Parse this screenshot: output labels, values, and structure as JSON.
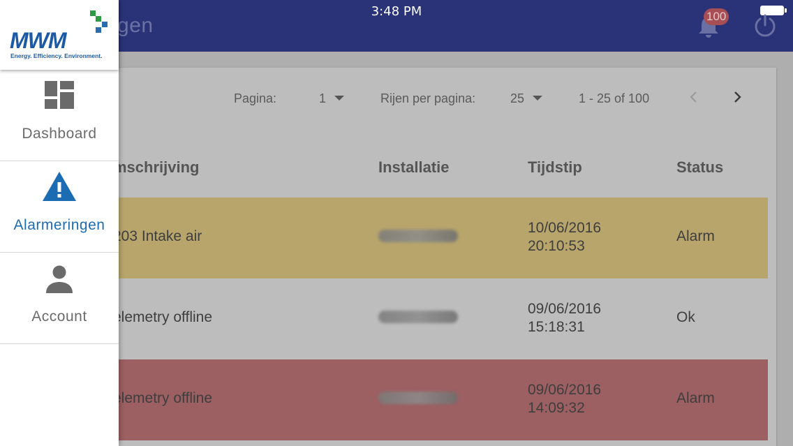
{
  "status_bar": {
    "time": "3:48 PM"
  },
  "header": {
    "title": "eringen",
    "notification_count": "100"
  },
  "pagination": {
    "page_label": "Pagina:",
    "page_value": "1",
    "rows_label": "Rijen per pagina:",
    "rows_value": "25",
    "range": "1 - 25 of 100"
  },
  "table": {
    "columns": [
      "mschrijving",
      "Installatie",
      "Tijdstip",
      "Status"
    ],
    "rows": [
      {
        "description": "203 Intake air",
        "date": "10/06/2016",
        "time": "20:10:53",
        "status": "Alarm"
      },
      {
        "description": "elemetry offline",
        "date": "09/06/2016",
        "time": "15:18:31",
        "status": "Ok"
      },
      {
        "description": "elemetry offline",
        "date": "09/06/2016",
        "time": "14:09:32",
        "status": "Alarm"
      }
    ]
  },
  "drawer": {
    "logo_text": "MWM",
    "logo_tagline": "Energy. Efficiency. Environment.",
    "items": [
      {
        "label": "Dashboard",
        "icon": "dashboard-icon"
      },
      {
        "label": "Alarmeringen",
        "icon": "warning-icon"
      },
      {
        "label": "Account",
        "icon": "person-icon"
      }
    ]
  },
  "colors": {
    "header": "#2a3377",
    "accent": "#1c6cb3",
    "alarm_yellow_row": "#b7a56c",
    "alarm_red_row": "#9c5f62"
  }
}
